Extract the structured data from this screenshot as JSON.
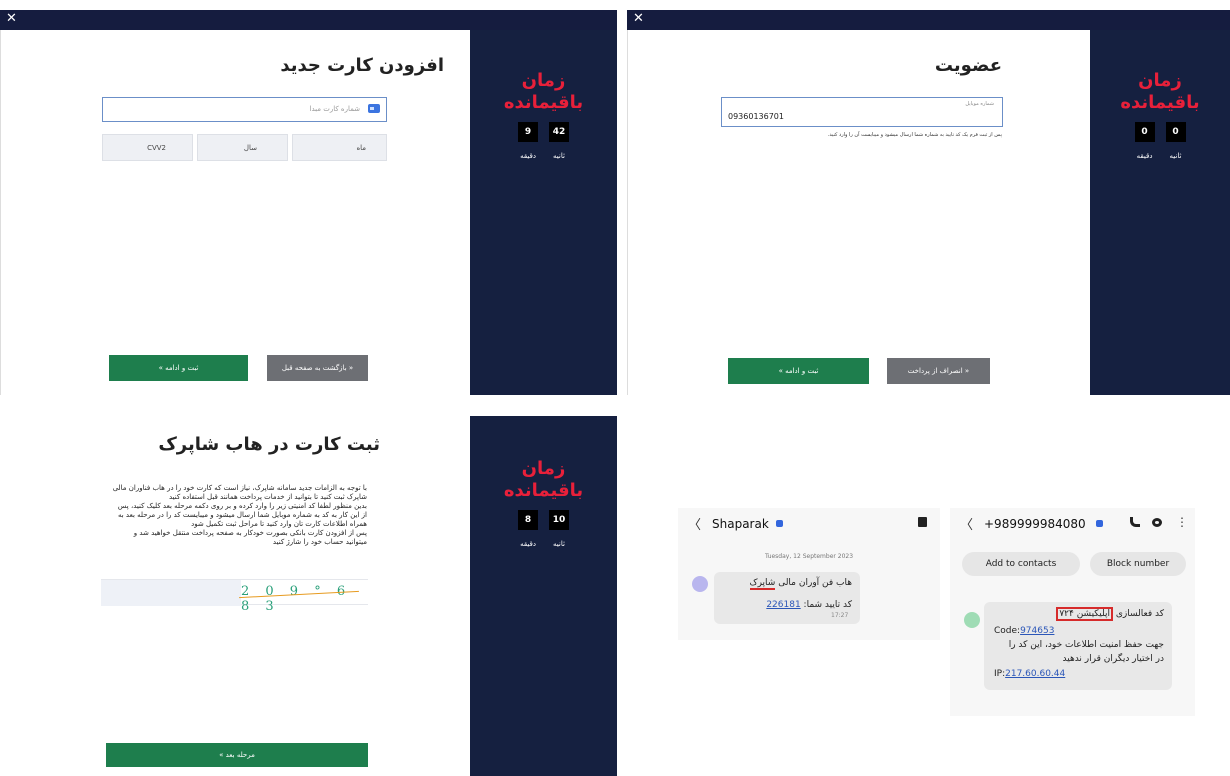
{
  "timer": {
    "title_line1": "زمان",
    "title_line2": "باقیمانده",
    "seconds_label": "ثانیه",
    "minutes_label": "دقیقه"
  },
  "close_glyph": "✕",
  "add_card": {
    "title": "افزودن کارت جدید",
    "card_placeholder": "شماره کارت مبدا",
    "month_label": "ماه",
    "year_label": "سال",
    "cvv_label": "CVV2",
    "timer_seconds": "42",
    "timer_minutes": "9",
    "submit_button": "ثبت و ادامه »",
    "back_button": "« بازگشت به صفحه قبل"
  },
  "membership": {
    "title": "عضویت",
    "phone_label": "شماره موبایل",
    "phone_value": "09360136701",
    "hint": "پس از ثبت فرم یک کد تایید به شماره شما ارسال میشود و میبایست آن را وارد کنید.",
    "timer_seconds": "0",
    "timer_minutes": "0",
    "submit_button": "ثبت و ادامه »",
    "cancel_button": "« انصراف از پرداخت"
  },
  "shaparak_hub": {
    "title": "ثبت کارت در هاب شاپرک",
    "paragraph": [
      "با توجه به الزامات جدید سامانه شاپرک، نیاز است که کارت خود را در هاب فناوران مالی",
      "شاپرک ثبت کنید تا بتوانید از خدمات پرداخت همانند قبل استفاده کنید",
      "بدین منظور لطفا کد امنیتی زیر را وارد کرده و بر روی دکمه مرحله بعد کلیک کنید، پس",
      "از این کار به کد به شماره موبایل شما ارسال میشود و میبایست کد را در مرحله بعد به",
      "همراه اطلاعات کارت تان وارد کنید تا مراحل ثبت تکمیل شود",
      "پس از افزودن کارت بانکی بصورت خودکار به صفحه پرداخت منتقل خواهید شد و",
      "میتوانید حساب خود را شارژ کنید"
    ],
    "captcha_text": "2 0 9 ° 6 8 3",
    "timer_seconds": "10",
    "timer_minutes": "8",
    "next_button": "مرحله بعد »"
  },
  "sms1": {
    "back_glyph": "〈",
    "sender": "Shaparak",
    "date": "Tuesday, 12 September 2023",
    "line1_prefix": "هاب فن آوران مالی ",
    "line1_underlined": "شاپرک",
    "line2_label": "کد تایید شما: ",
    "code": "226181",
    "time": "17:27"
  },
  "sms2": {
    "back_glyph": "〈",
    "sender": "+989999984080",
    "add_contacts": "Add to contacts",
    "block_number": "Block number",
    "line1_prefix": "کد فعالسازی ",
    "line1_boxed": "اپلیکیشن ۷۲۴",
    "code_label": "Code:",
    "code": "974653",
    "line3": "جهت حفظ امنیت اطلاعات خود، این کد را",
    "line4": "در اختیار دیگران قرار ندهید",
    "ip_label": "IP:",
    "ip": "217.60.60.44",
    "more_glyph": "⋮"
  }
}
